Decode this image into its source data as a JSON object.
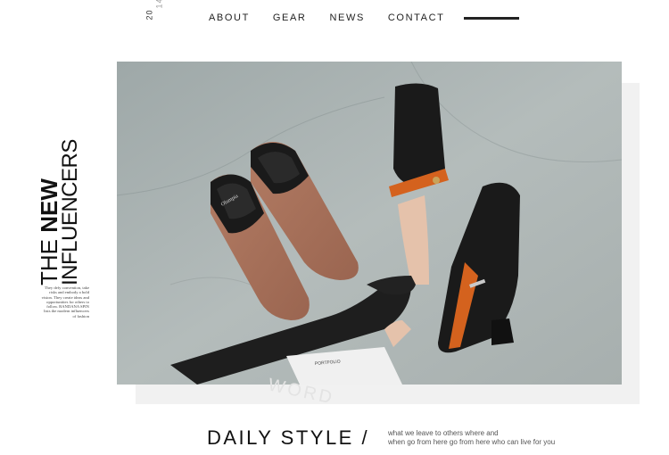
{
  "year": {
    "part1": "20",
    "part2": "14"
  },
  "nav": {
    "items": [
      {
        "label": "ABOUT"
      },
      {
        "label": "GEAR"
      },
      {
        "label": "NEWS"
      },
      {
        "label": "CONTACT"
      }
    ]
  },
  "side": {
    "title_the": "THE ",
    "title_new": "NEW",
    "title_influencers": "INFLUENCERS",
    "blurb": "They defy convention, take risks and embody a bold vision. They create ideas and opportunities for others to follow. BANDANA SPIN lists the modern influencers of fashion"
  },
  "hero": {
    "alt": "shoes photo",
    "portfolio_label": "PORTFOLIO"
  },
  "footer": {
    "title": "DAILY STYLE /",
    "tagline1": "what we leave to others where and",
    "tagline2": "when go from here go from here who can live for you",
    "wordmark": "WORD"
  },
  "colors": {
    "accent": "#222222",
    "background": "#ffffff",
    "strap": "#d4621e"
  }
}
